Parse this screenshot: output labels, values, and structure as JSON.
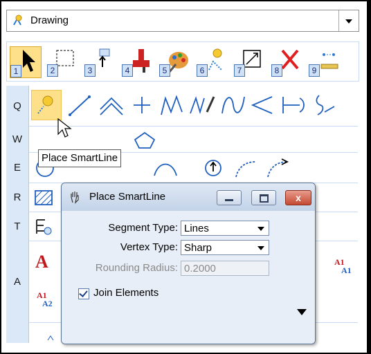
{
  "task_dropdown": {
    "selected": "Drawing"
  },
  "toolbar": {
    "tools": [
      {
        "num": "1",
        "icon": "arrow-pointer-icon"
      },
      {
        "num": "2",
        "icon": "selection-box-icon"
      },
      {
        "num": "3",
        "icon": "move-icon"
      },
      {
        "num": "4",
        "icon": "paint-brush-icon"
      },
      {
        "num": "5",
        "icon": "palette-icon"
      },
      {
        "num": "6",
        "icon": "smart-line-icon"
      },
      {
        "num": "7",
        "icon": "copy-fence-icon"
      },
      {
        "num": "8",
        "icon": "delete-x-icon"
      },
      {
        "num": "9",
        "icon": "measure-icon"
      }
    ]
  },
  "rows": [
    {
      "key": "Q"
    },
    {
      "key": "W"
    },
    {
      "key": "E"
    },
    {
      "key": "R"
    },
    {
      "key": "T"
    },
    {
      "key": "A"
    }
  ],
  "tooltip": {
    "text": "Place SmartLine"
  },
  "dialog": {
    "title": "Place SmartLine",
    "segment_type_label": "Segment Type:",
    "segment_type_value": "Lines",
    "vertex_type_label": "Vertex Type:",
    "vertex_type_value": "Sharp",
    "rounding_radius_label": "Rounding Radius:",
    "rounding_radius_value": "0.2000",
    "join_elements_label": "Join Elements",
    "join_elements_checked": true,
    "close_glyph": "x"
  },
  "text_row_glyphs": {
    "big_a": "A",
    "a1_label": "A1",
    "a1_small": "A1",
    "a2": "A2"
  },
  "colors": {
    "accent": "#4a73b4",
    "selected": "#ffe08a",
    "close": "#c34a33"
  }
}
